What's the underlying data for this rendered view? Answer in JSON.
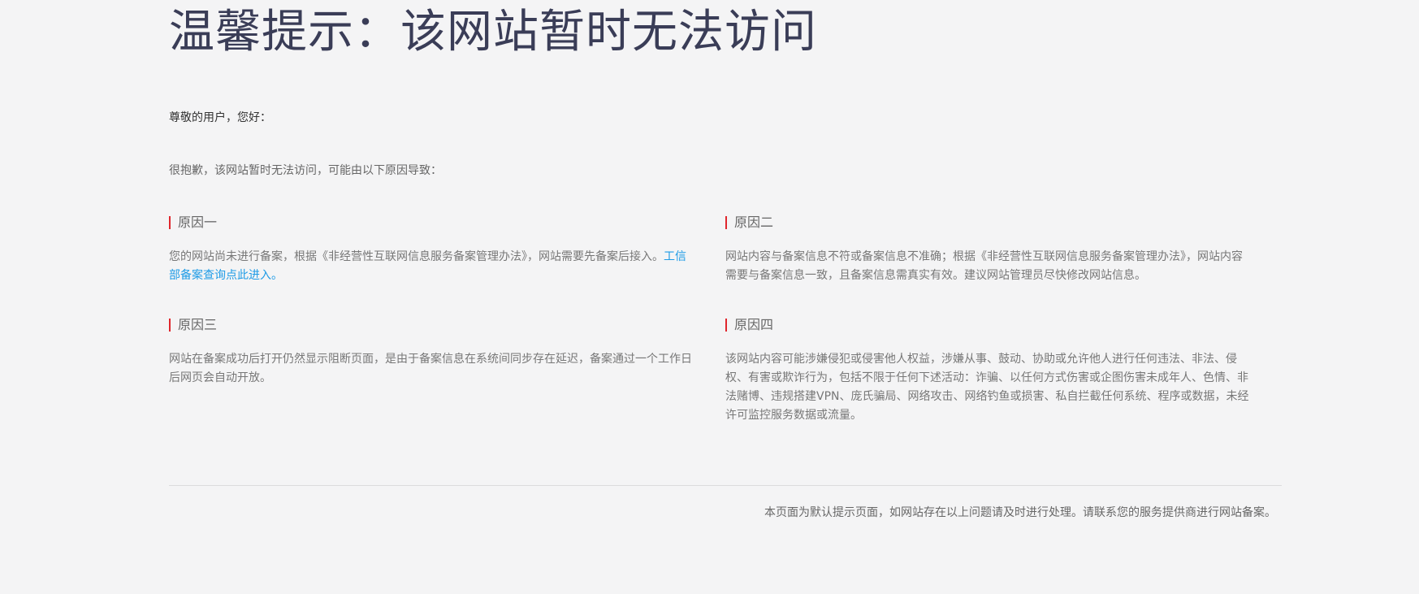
{
  "page": {
    "title": "温馨提示：该网站暂时无法访问",
    "greeting": "尊敬的用户，您好：",
    "intro": "很抱歉，该网站暂时无法访问，可能由以下原因导致："
  },
  "reasons": [
    {
      "title": "原因一",
      "text": "您的网站尚未进行备案，根据《非经营性互联网信息服务备案管理办法》，网站需要先备案后接入。",
      "link": "工信部备案查询点此进入。"
    },
    {
      "title": "原因二",
      "text": "网站内容与备案信息不符或备案信息不准确；根据《非经营性互联网信息服务备案管理办法》，网站内容需要与备案信息一致，且备案信息需真实有效。建议网站管理员尽快修改网站信息。"
    },
    {
      "title": "原因三",
      "text": "网站在备案成功后打开仍然显示阻断页面，是由于备案信息在系统间同步存在延迟，备案通过一个工作日后网页会自动开放。"
    },
    {
      "title": "原因四",
      "text": "该网站内容可能涉嫌侵犯或侵害他人权益，涉嫌从事、鼓动、协助或允许他人进行任何违法、非法、侵权、有害或欺诈行为，包括不限于任何下述活动：诈骗、以任何方式伤害或企图伤害未成年人、色情、非法赌博、违规搭建VPN、庞氏骗局、网络攻击、网络钓鱼或损害、私自拦截任何系统、程序或数据，未经许可监控服务数据或流量。"
    }
  ],
  "footer": {
    "text": "本页面为默认提示页面，如网站存在以上问题请及时进行处理。请联系您的服务提供商进行网站备案。"
  },
  "colors": {
    "background": "#f4f4f5",
    "title": "#3a3d57",
    "accent_bar": "#e0262d",
    "link": "#1e9be6"
  }
}
